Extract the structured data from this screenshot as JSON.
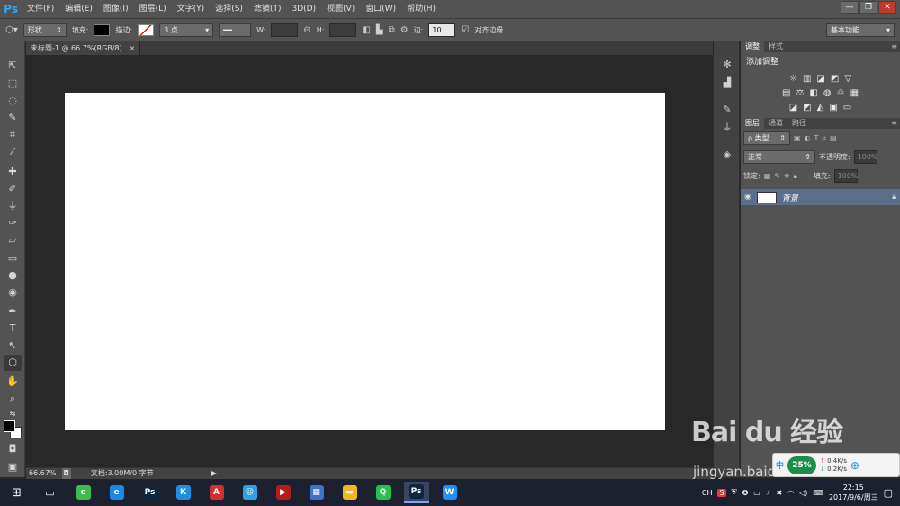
{
  "app": {
    "logo": "Ps"
  },
  "menu": [
    "文件(F)",
    "编辑(E)",
    "图像(I)",
    "图层(L)",
    "文字(Y)",
    "选择(S)",
    "滤镜(T)",
    "3D(D)",
    "视图(V)",
    "窗口(W)",
    "帮助(H)"
  ],
  "window_controls": {
    "minimize": "—",
    "restore": "❐",
    "close": "✕"
  },
  "options": {
    "mode": "形状",
    "fill_label": "填充:",
    "stroke_label": "描边:",
    "stroke_size": "3 点",
    "w_label": "W:",
    "h_label": "H:",
    "sides_label": "边:",
    "sides_value": "10",
    "align_edges_label": "对齐边缘",
    "align_edges_checked": true,
    "workspace": "基本功能",
    "fill_color": "#000000"
  },
  "document": {
    "tab_title": "未标题-1 @ 66.7%(RGB/8)",
    "close_glyph": "×",
    "canvas_color": "#ffffff"
  },
  "status": {
    "zoom": "66.67%",
    "doc_info": "文档:3.00M/0 字节"
  },
  "panels": {
    "adjust_tabs": [
      "调整",
      "样式"
    ],
    "adjust_title": "添加调整",
    "layer_tabs": [
      "图层",
      "通道",
      "路径"
    ],
    "filter_kind": "ρ 类型",
    "blend_mode": "正常",
    "opacity_label": "不透明度:",
    "opacity_value": "100%",
    "lock_label": "锁定:",
    "fill_label": "填充:",
    "fill_value": "100%",
    "layer_name": "背景"
  },
  "taskbar": {
    "apps": [
      {
        "name": "360",
        "color": "#3dbb4f",
        "glyph": "e"
      },
      {
        "name": "IE",
        "color": "#1e88e5",
        "glyph": "e"
      },
      {
        "name": "Photoshop",
        "color": "#0b2742",
        "glyph": "Ps"
      },
      {
        "name": "Kuwo",
        "color": "#1f8de0",
        "glyph": "K"
      },
      {
        "name": "Acrobat",
        "color": "#d32f2f",
        "glyph": "A"
      },
      {
        "name": "QQ",
        "color": "#2aa3e3",
        "glyph": "☺"
      },
      {
        "name": "Media",
        "color": "#b71c1c",
        "glyph": "▶"
      },
      {
        "name": "Film",
        "color": "#3f72c8",
        "glyph": "▦"
      },
      {
        "name": "Explorer",
        "color": "#f3b61f",
        "glyph": "▬"
      },
      {
        "name": "iQIYI",
        "color": "#27c24c",
        "glyph": "Q"
      },
      {
        "name": "Photoshop-active",
        "color": "#0b2742",
        "glyph": "Ps"
      },
      {
        "name": "WPS",
        "color": "#1e90ff",
        "glyph": "W"
      }
    ],
    "tray_lang": "CH",
    "ime_glyph": "S",
    "time": "22:15",
    "date": "2017/9/6/周三"
  },
  "net": {
    "cpu": "25%",
    "ime": "中",
    "up": "0.4K/s",
    "down": "0.2K/s"
  },
  "watermark": {
    "main": "Bai du 经验",
    "url": "jingyan.baidu.com"
  }
}
